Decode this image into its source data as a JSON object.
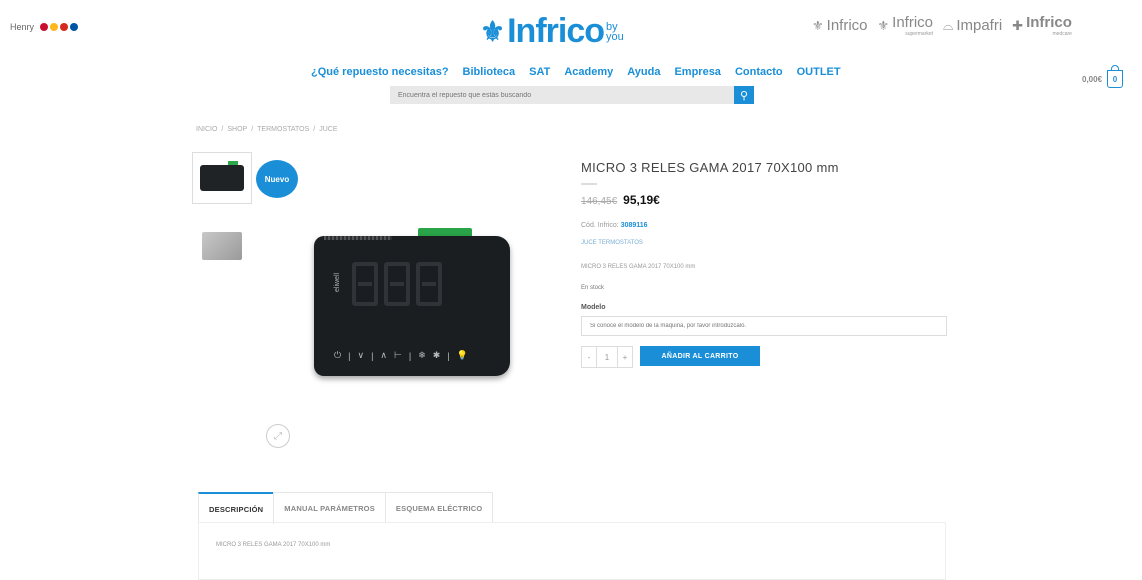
{
  "header": {
    "user": "Henry",
    "logo_mark": "⚜",
    "logo_text": "Infrico",
    "logo_by": "by",
    "logo_you": "you",
    "brands": [
      {
        "name": "Infrico",
        "sub": ""
      },
      {
        "name": "Infrico",
        "sub": "supermarket"
      },
      {
        "name": "Impafri",
        "sub": ""
      },
      {
        "name": "Infrico",
        "sub": "medcare"
      }
    ]
  },
  "nav": {
    "items": [
      "¿Qué repuesto necesitas?",
      "Biblioteca",
      "SAT",
      "Academy",
      "Ayuda",
      "Empresa",
      "Contacto",
      "OUTLET"
    ]
  },
  "search": {
    "placeholder": "Encuentra el repuesto que estás buscando"
  },
  "cart": {
    "total": "0,00€",
    "count": "0"
  },
  "breadcrumb": [
    "INICIO",
    "SHOP",
    "TERMOSTATOS",
    "JUCE"
  ],
  "product": {
    "badge": "Nuevo",
    "title": "MICRO 3 RELES GAMA 2017 70X100 mm",
    "old_price": "146,45€",
    "new_price": "95,19€",
    "code_label": "Cód. Infrico:",
    "code": "3089116",
    "category": "JUCE TERMOSTATOS",
    "short_desc": "MICRO 3 RELES GAMA 2017 70X100 mm",
    "stock": "En stock",
    "model_label": "Modelo",
    "model_placeholder": "Si conoce el modelo de la máquina, por favor introdúzcalo.",
    "qty": "1",
    "add_to_cart": "AÑADIR AL CARRITO",
    "device_brand": "eliwell",
    "device_keys": [
      "⏻",
      "|",
      "∨",
      "|",
      "∧",
      "⊢",
      "|",
      "❄",
      "✱",
      "|",
      "💡"
    ]
  },
  "tabs": {
    "items": [
      "DESCRIPCIÓN",
      "MANUAL PARÁMETROS",
      "ESQUEMA ELÉCTRICO"
    ],
    "active": 0,
    "content": "MICRO 3 RELES GAMA 2017 70X100 mm"
  },
  "colors": {
    "accent": "#1a8fd8",
    "connector": "#2aa448"
  }
}
